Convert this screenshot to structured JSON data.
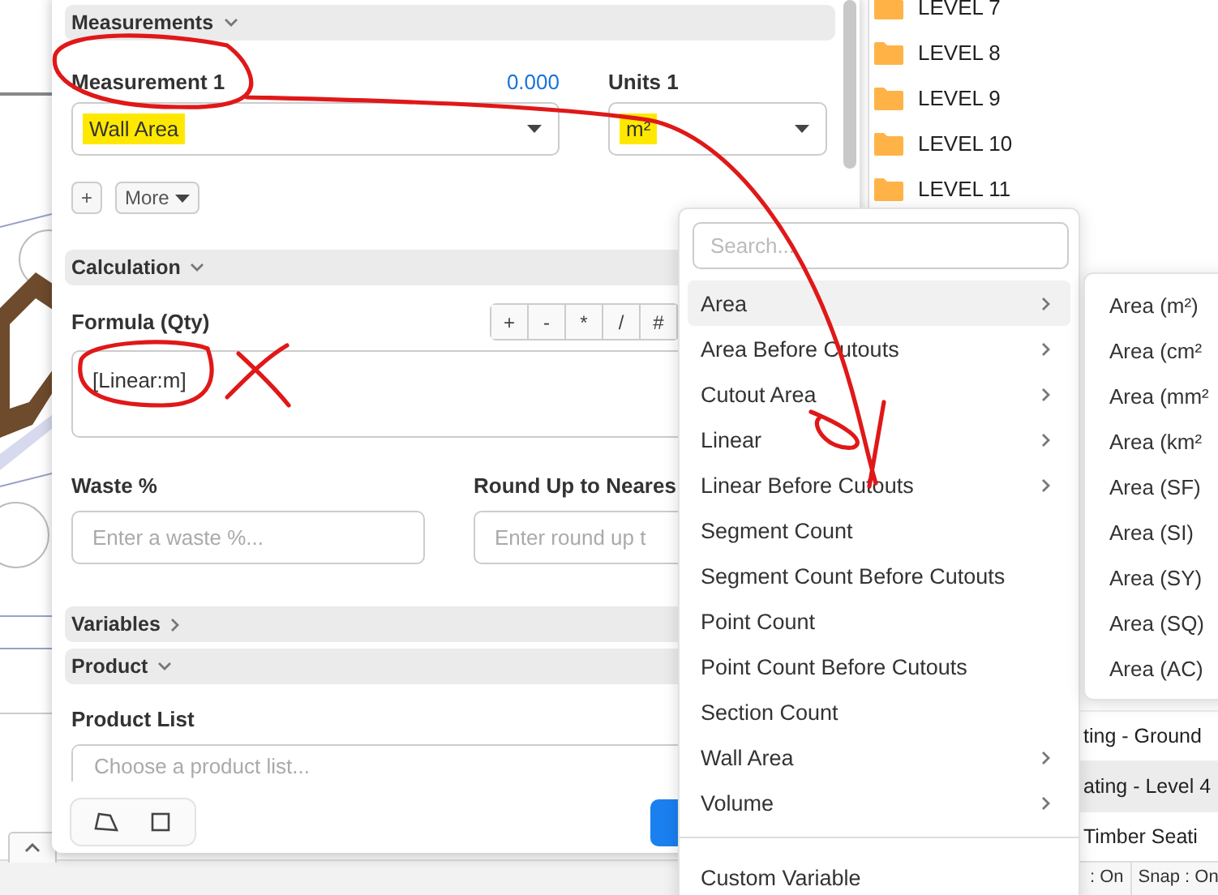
{
  "measurements_section": {
    "title": "Measurements",
    "expanded": true
  },
  "measurement": {
    "label": "Measurement 1",
    "value": "0.000",
    "select": "Wall Area",
    "highlighted": true
  },
  "units": {
    "label": "Units 1",
    "select": "m²",
    "highlighted": true
  },
  "add_button": "+",
  "more_button": "More",
  "calculation_section": {
    "title": "Calculation",
    "expanded": true
  },
  "formula": {
    "label": "Formula (Qty)",
    "operators": [
      "+",
      "-",
      "*",
      "/",
      "#"
    ],
    "value": "[Linear:m]"
  },
  "waste": {
    "label": "Waste %",
    "placeholder": "Enter a waste %..."
  },
  "round_up": {
    "label": "Round Up to Neares",
    "placeholder": "Enter round up t"
  },
  "variables_section": {
    "title": "Variables",
    "expanded": false
  },
  "product_section": {
    "title": "Product",
    "expanded": true
  },
  "product_list": {
    "label": "Product List",
    "placeholder": "Choose a product list..."
  },
  "menu": {
    "search_placeholder": "Search...",
    "items": [
      {
        "label": "Area",
        "submenu": true,
        "selected": true
      },
      {
        "label": "Area Before Cutouts",
        "submenu": true,
        "selected": false
      },
      {
        "label": "Cutout Area",
        "submenu": true,
        "selected": false
      },
      {
        "label": "Linear",
        "submenu": true,
        "selected": false
      },
      {
        "label": "Linear Before Cutouts",
        "submenu": true,
        "selected": false
      },
      {
        "label": "Segment Count",
        "submenu": false,
        "selected": false
      },
      {
        "label": "Segment Count Before Cutouts",
        "submenu": false,
        "selected": false
      },
      {
        "label": "Point Count",
        "submenu": false,
        "selected": false
      },
      {
        "label": "Point Count Before Cutouts",
        "submenu": false,
        "selected": false
      },
      {
        "label": "Section Count",
        "submenu": false,
        "selected": false
      },
      {
        "label": "Wall Area",
        "submenu": true,
        "selected": false
      },
      {
        "label": "Volume",
        "submenu": true,
        "selected": false
      }
    ],
    "footer": "Custom Variable"
  },
  "submenu": {
    "items": [
      "Area (m²)",
      "Area (cm²",
      "Area (mm²",
      "Area (km²",
      "Area (SF)",
      "Area (SI)",
      "Area (SY)",
      "Area (SQ)",
      "Area (AC)"
    ]
  },
  "levels": [
    "LEVEL 7",
    "LEVEL 8",
    "LEVEL 9",
    "LEVEL 10",
    "LEVEL 11"
  ],
  "layers": [
    {
      "label": "ting - Ground",
      "selected": false
    },
    {
      "label": "ating - Level 4",
      "selected": true
    },
    {
      "label": "Timber Seati",
      "selected": false
    }
  ],
  "status_bar": [
    ": On",
    "Snap : On"
  ]
}
